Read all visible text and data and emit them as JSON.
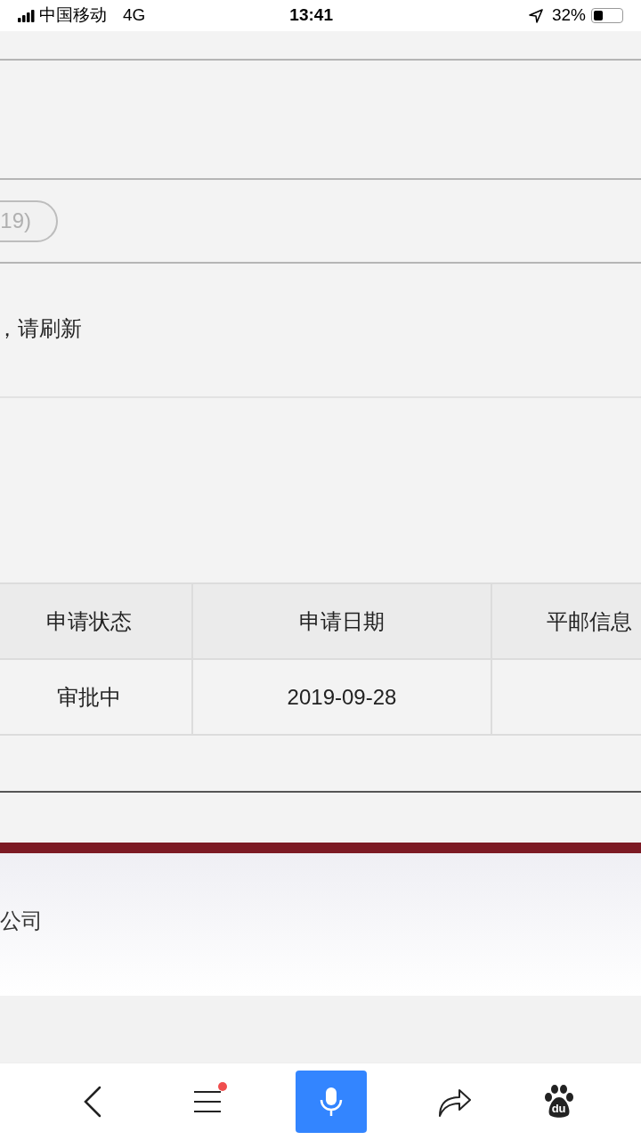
{
  "status_bar": {
    "carrier": "中国移动",
    "network": "4G",
    "time": "13:41",
    "battery": "32%"
  },
  "pill_button": {
    "label": "19)"
  },
  "notice": "，请刷新",
  "table": {
    "columns": [
      "申请状态",
      "申请日期",
      "平邮信息"
    ],
    "rows": [
      [
        "审批中",
        "2019-09-28",
        ""
      ]
    ]
  },
  "footer": {
    "text": "公司"
  },
  "bottom_bar": {
    "menu_badge": true,
    "logo_text": "du"
  }
}
